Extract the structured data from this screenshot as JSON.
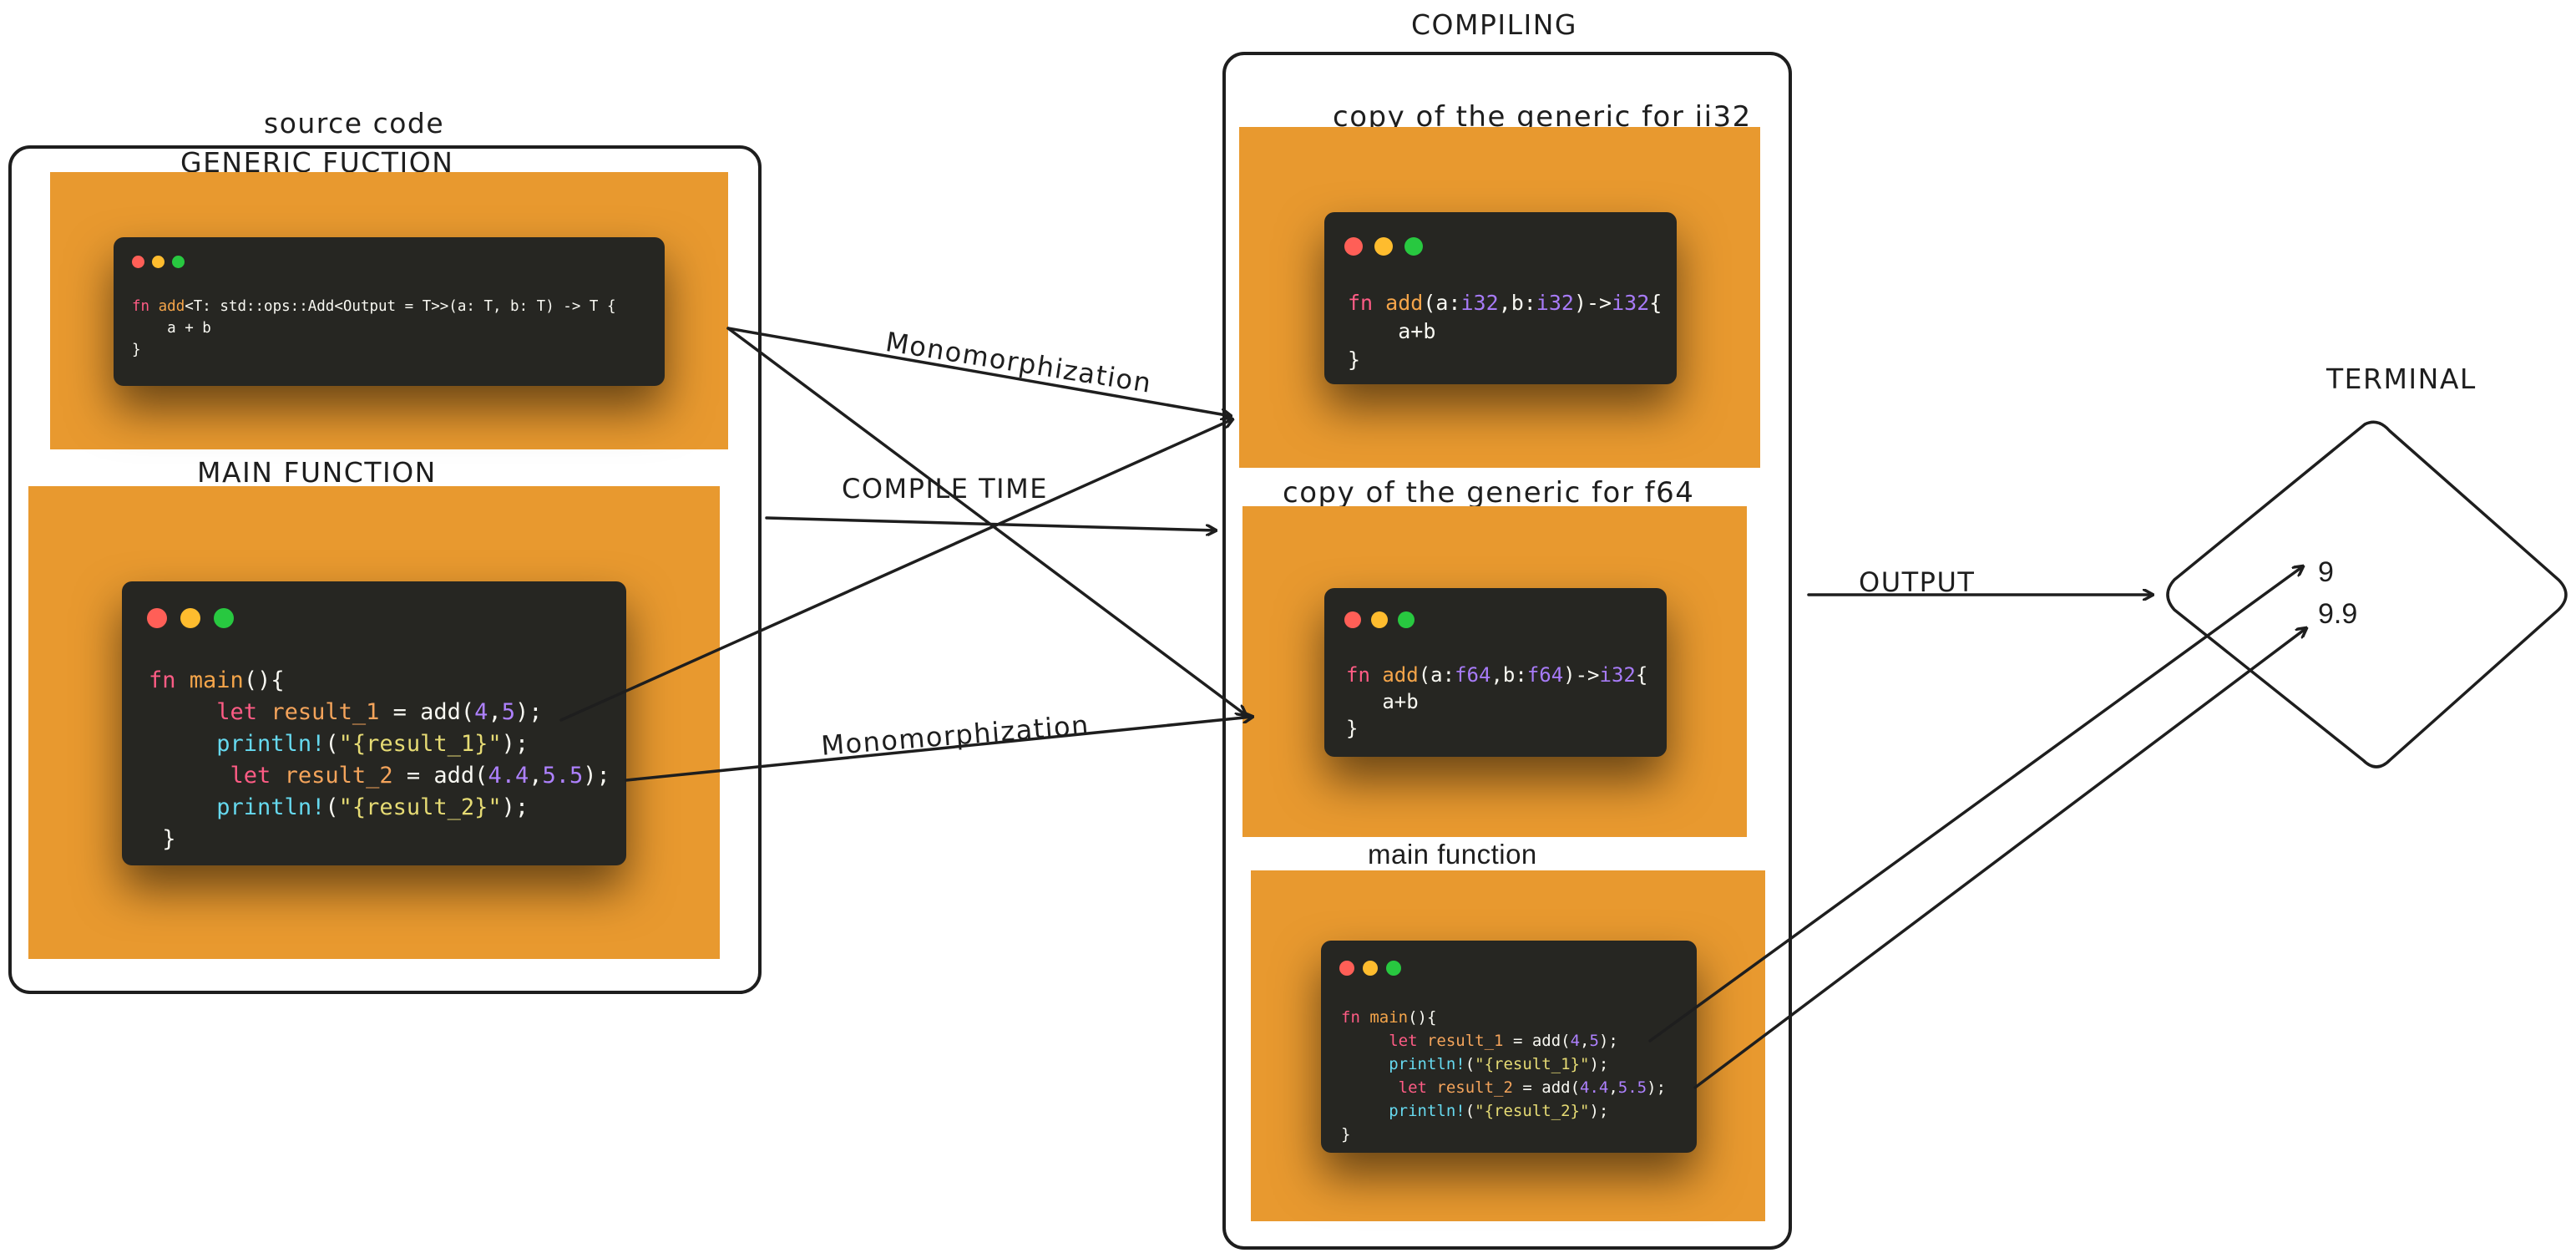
{
  "labels": {
    "source_code": "source code",
    "generic_function": "GENERIC FUCTION",
    "main_function_upper": "MAIN FUNCTION",
    "compiling": "COMPILING",
    "copy_i32": "copy of the generic for ii32",
    "copy_f64": "copy of the generic for f64",
    "main_function_lower": "main function",
    "terminal": "TERMINAL",
    "monomorphization_top": "Monomorphization",
    "monomorphization_bottom": "Monomorphization",
    "compile_time": "COMPILE TIME",
    "output": "OUTPUT"
  },
  "code": {
    "generic": {
      "l1_kw": "fn",
      "l1_name": "add",
      "l1_rest": "<T: std::ops::Add<Output = T>>(a: T, b: T) -> T {",
      "l2": "    a + b",
      "l3": "}"
    },
    "main": {
      "l1_kw": "fn",
      "l1_name": "main",
      "l1_rest": "(){",
      "l2_kw": "let",
      "l2_var": "result_1",
      "l2_mid": " = add(",
      "l2_n1": "4",
      "l2_c": ",",
      "l2_n2": "5",
      "l2_end": ");",
      "l3_mac": "println!",
      "l3_p1": "(",
      "l3_str": "\"{result_1}\"",
      "l3_p2": ");",
      "l4_kw": "let",
      "l4_var": "result_2",
      "l4_mid": " = add(",
      "l4_n1": "4.4",
      "l4_c": ",",
      "l4_n2": "5.5",
      "l4_end": ");",
      "l5_mac": "println!",
      "l5_p1": "(",
      "l5_str": "\"{result_2}\"",
      "l5_p2": ");",
      "l6": "}"
    },
    "i32": {
      "kw": "fn",
      "name": "add",
      "p1": "(a:",
      "t1": "i32",
      "p2": ",b:",
      "t2": "i32",
      "p3": ")->",
      "t3": "i32",
      "p4": "{",
      "body": "a+b",
      "close": "}"
    },
    "f64": {
      "kw": "fn",
      "name": "add",
      "p1": "(a:",
      "t1": "f64",
      "p2": ",b:",
      "t2": "f64",
      "p3": ")->",
      "t3": "i32",
      "p4": "{",
      "body": "a+b",
      "close": "}"
    }
  },
  "terminal": {
    "output_1": "9",
    "output_2": "9.9"
  },
  "colors": {
    "panel": "#e8992f",
    "code_bg": "#262622",
    "dot_red": "#ff5f57",
    "dot_yellow": "#febc2e",
    "dot_green": "#28c840",
    "stroke": "#1e1e1e"
  }
}
